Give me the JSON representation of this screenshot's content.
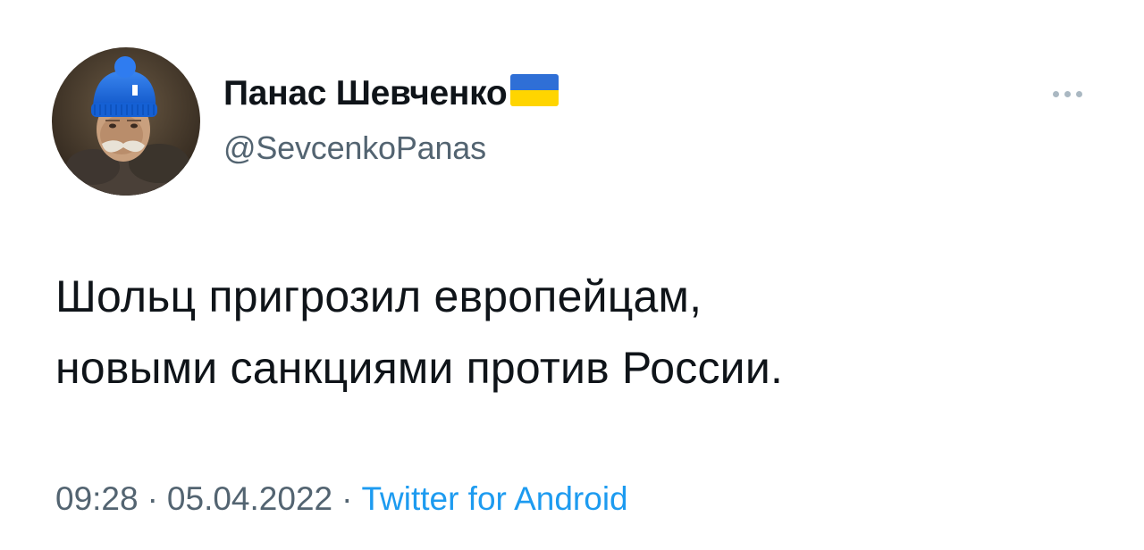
{
  "author": {
    "display_name": "Панас Шевченко",
    "handle": "@SevcenkoPanas",
    "flag_icon": "ukraine-flag-icon",
    "flag_colors": {
      "top": "#2f6fd6",
      "bottom": "#ffd500"
    },
    "avatar_icon": "profile-portrait-avatar"
  },
  "more_icon": "more-horizontal-icon",
  "tweet": {
    "lines": [
      "Шольц пригрозил европейцам,",
      "новыми санкциями против России."
    ]
  },
  "meta": {
    "time": "09:28",
    "separator": "·",
    "date": "05.04.2022",
    "source": "Twitter for Android"
  },
  "colors": {
    "text": "#0f1419",
    "secondary": "#536471",
    "link": "#1d9bf0",
    "background": "#ffffff"
  }
}
